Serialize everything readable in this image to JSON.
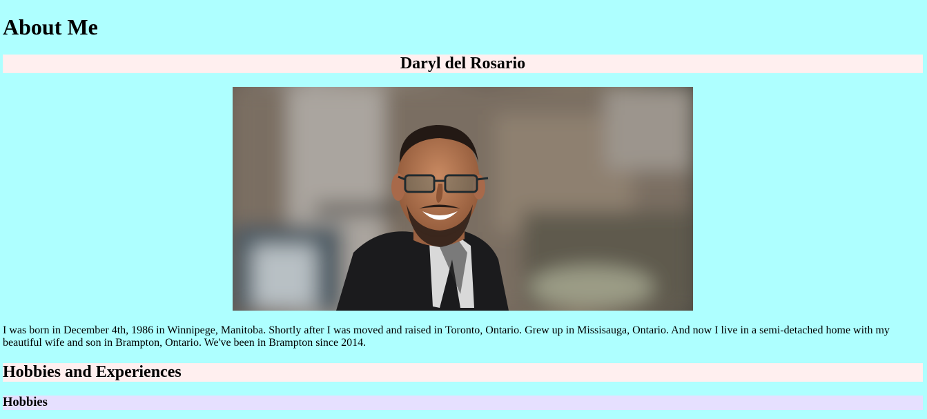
{
  "page": {
    "title": "About Me",
    "name_heading": "Daryl del Rosario",
    "photo": {
      "alt": "Portrait of Daryl del Rosario smiling with glasses, motion-blurred background"
    },
    "bio": "I was born in December 4th, 1986 in Winnipege, Manitoba. Shortly after I was moved and raised in Toronto, Ontario. Grew up in Missisauga, Ontario. And now I live in a semi-detached home with my beautiful wife and son in Brampton, Ontario. We've been in Brampton since 2014.",
    "sections": [
      {
        "heading": "Hobbies and Experiences",
        "subheadings": [
          "Hobbies"
        ]
      }
    ]
  },
  "colors": {
    "page_background": "#aeffff",
    "heading_band": "#ffefef",
    "subheading_band": "#e6e0ff"
  }
}
